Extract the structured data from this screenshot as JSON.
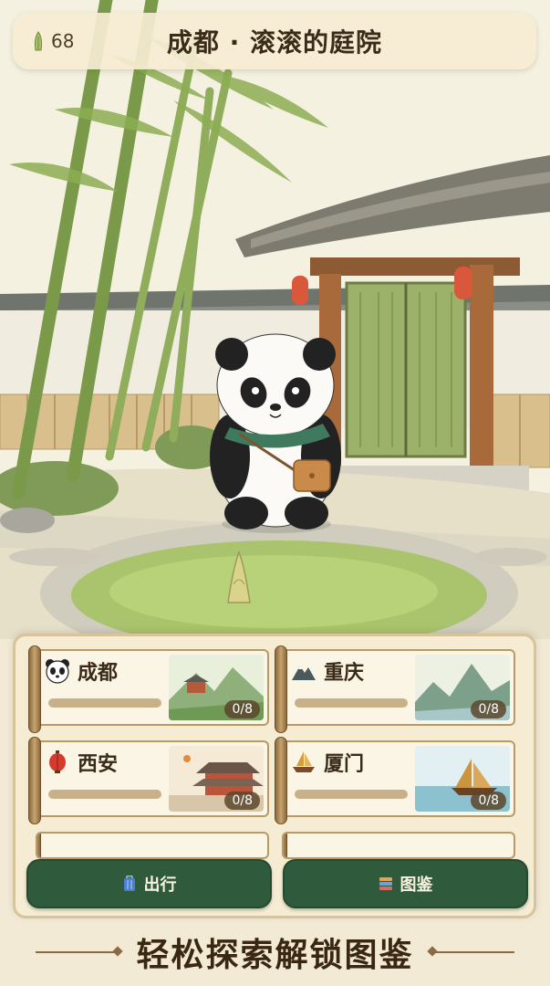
{
  "header": {
    "currency_icon": "bamboo-shoot-icon",
    "currency_value": "68",
    "title": "成都 · 滚滚的庭院"
  },
  "scene": {
    "character": "panda",
    "items": [
      "bamboo-shoot"
    ]
  },
  "cities": [
    {
      "name": "成都",
      "icon": "panda-icon",
      "progress": "0/8",
      "progress_fraction": 0
    },
    {
      "name": "重庆",
      "icon": "mountain-icon",
      "progress": "0/8",
      "progress_fraction": 0
    },
    {
      "name": "西安",
      "icon": "lantern-icon",
      "progress": "0/8",
      "progress_fraction": 0
    },
    {
      "name": "厦门",
      "icon": "sailboat-icon",
      "progress": "0/8",
      "progress_fraction": 0
    }
  ],
  "actions": {
    "travel_label": "出行",
    "travel_icon": "luggage-icon",
    "collection_label": "图鉴",
    "collection_icon": "book-icon"
  },
  "footer": {
    "slogan": "轻松探索解锁图鉴"
  },
  "colors": {
    "button_green": "#2f5a3b",
    "panel_bg": "#f5ecd3",
    "text_dark": "#3b2b1a"
  }
}
